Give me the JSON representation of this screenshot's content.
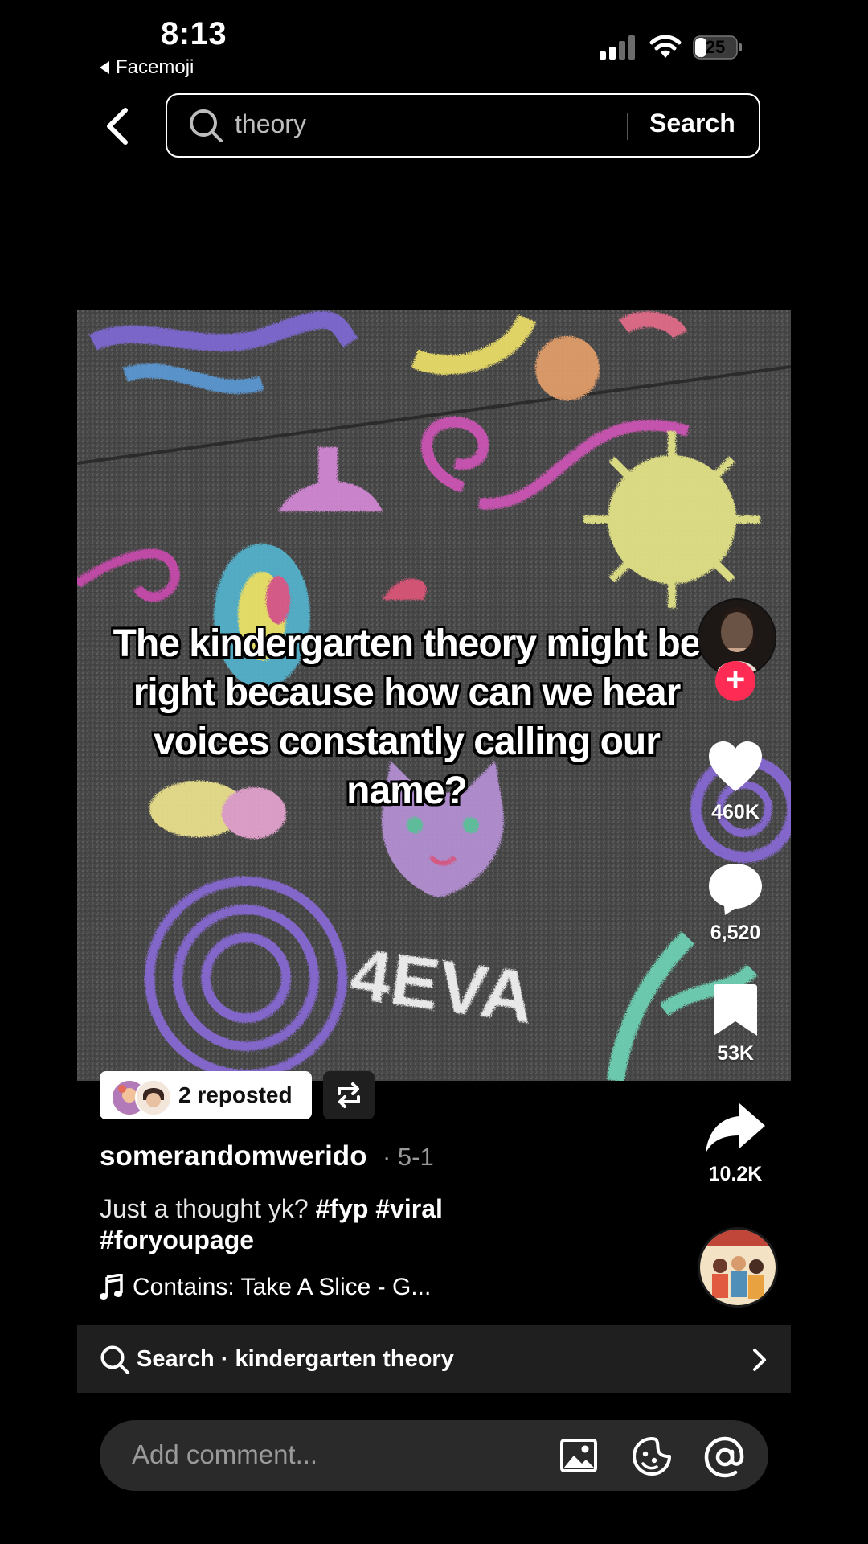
{
  "status_bar": {
    "time": "8:13",
    "back_app": "Facemoji",
    "battery": "25"
  },
  "search": {
    "query": "theory",
    "submit_label": "Search"
  },
  "video": {
    "caption": "The kindergarten theory might be right because how can we hear voices constantly calling our name?",
    "chalk_text": "4EVA"
  },
  "actions": {
    "likes": "460K",
    "comments": "6,520",
    "saves": "53K",
    "shares": "10.2K"
  },
  "repost": {
    "label": "2 reposted"
  },
  "post": {
    "username": "somerandomwerido",
    "date": "· 5-1",
    "description_text": "Just a thought yk?",
    "hashtags": [
      "#fyp",
      "#viral",
      "#foryoupage"
    ],
    "music": "Contains: Take A Slice - G..."
  },
  "suggestion": {
    "text": "Search · kindergarten theory"
  },
  "comment_bar": {
    "placeholder": "Add comment..."
  },
  "colors": {
    "background": "#000000",
    "accent_red": "#fe2c55",
    "bar_gray": "#1f1f1f",
    "input_gray": "#2a2a2a"
  },
  "icons": [
    "back-arrow-icon",
    "search-icon",
    "signal-icon",
    "wifi-icon",
    "battery-icon",
    "heart-icon",
    "comment-icon",
    "bookmark-icon",
    "share-icon",
    "repost-icon",
    "music-note-icon",
    "chevron-right-icon",
    "image-icon",
    "emoji-icon",
    "mention-icon"
  ]
}
